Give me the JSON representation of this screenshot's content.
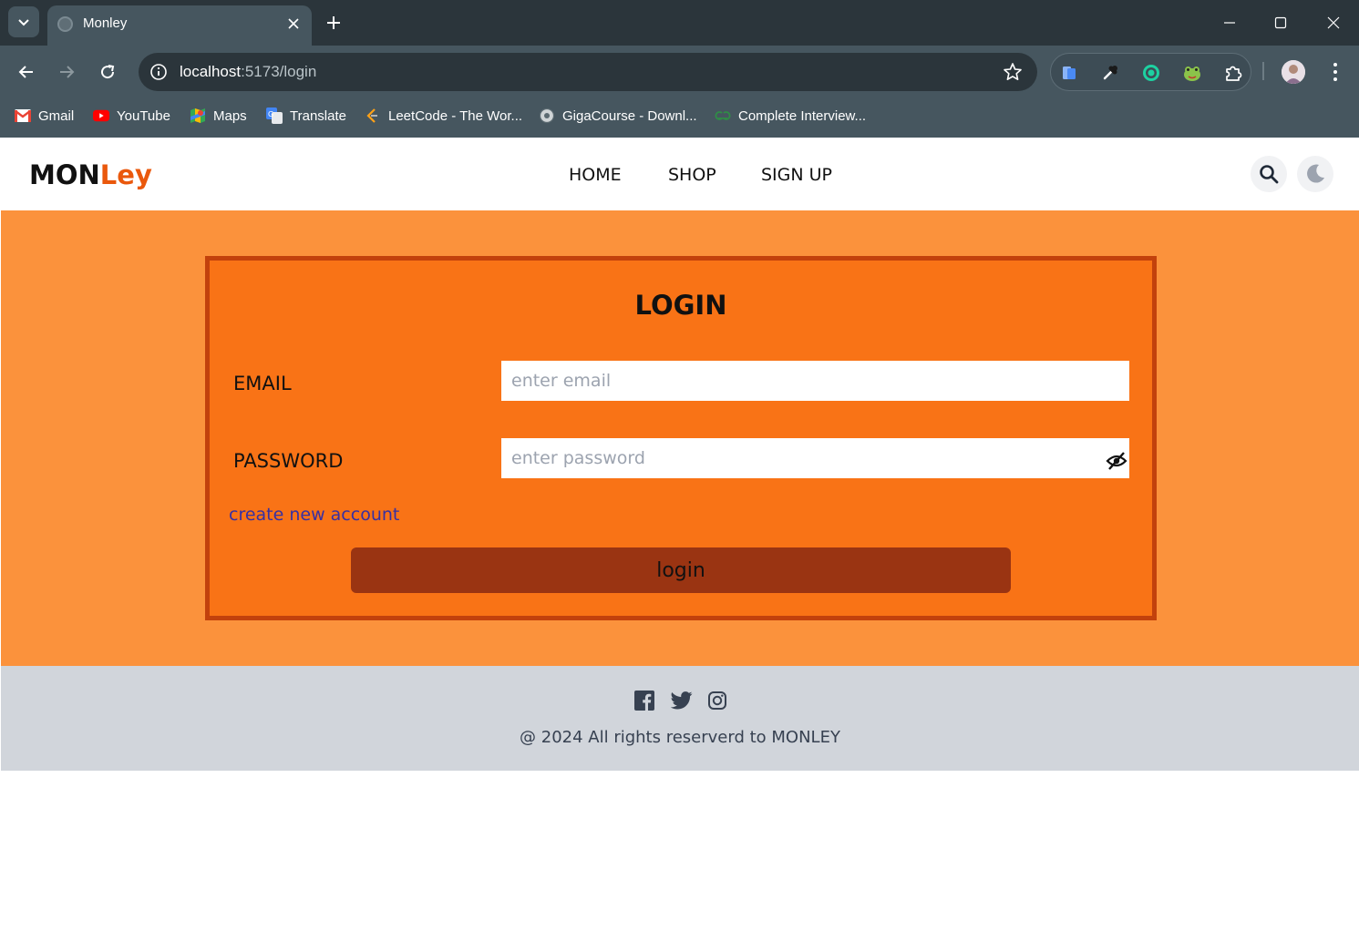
{
  "browser": {
    "tab_title": "Monley",
    "url_host": "localhost",
    "url_path": ":5173/login",
    "bookmarks": [
      {
        "label": "Gmail",
        "icon": "gmail-icon"
      },
      {
        "label": "YouTube",
        "icon": "youtube-icon"
      },
      {
        "label": "Maps",
        "icon": "maps-icon"
      },
      {
        "label": "Translate",
        "icon": "translate-icon"
      },
      {
        "label": "LeetCode - The Wor...",
        "icon": "leetcode-icon"
      },
      {
        "label": "GigaCourse - Downl...",
        "icon": "gigacourse-icon"
      },
      {
        "label": "Complete Interview...",
        "icon": "gfg-icon"
      }
    ]
  },
  "header": {
    "logo_part1": "MON",
    "logo_part2": "Ley",
    "nav": [
      "HOME",
      "SHOP",
      "SIGN UP"
    ]
  },
  "login": {
    "title": "LOGIN",
    "email_label": "EMAIL",
    "email_placeholder": "enter email",
    "password_label": "PASSWORD",
    "password_placeholder": "enter password",
    "create_account": "create new account",
    "submit": "login"
  },
  "footer": {
    "social": [
      "facebook-icon",
      "twitter-icon",
      "instagram-icon"
    ],
    "copyright": "@ 2024 All rights reserverd to MONLEY"
  },
  "colors": {
    "accent": "#ea580c",
    "main_bg": "#fb923c",
    "card_bg": "#f97316",
    "card_border": "#c2410c",
    "button": "#9a3412",
    "footer_bg": "#d1d5db",
    "link": "#3730a3"
  }
}
